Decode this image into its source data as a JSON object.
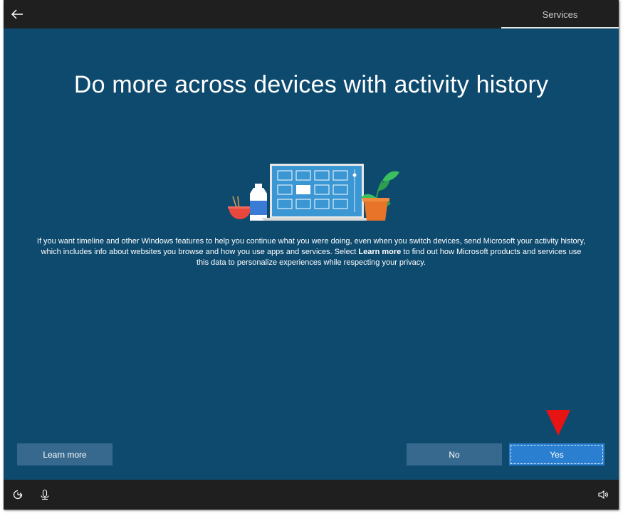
{
  "header": {
    "tab_label": "Services"
  },
  "main": {
    "title": "Do more across devices with activity history",
    "body_before_bold": "If you want timeline and other Windows features to help you continue what you were doing, even when you switch devices, send Microsoft your activity history, which includes info about websites you browse and how you use apps and services. Select ",
    "body_bold": "Learn more",
    "body_after_bold": " to find out how Microsoft products and services use this data to personalize experiences while respecting your privacy."
  },
  "buttons": {
    "learn_more": "Learn more",
    "no": "No",
    "yes": "Yes"
  },
  "icons": {
    "back": "back-arrow-icon",
    "ease_of_access": "ease-of-access-icon",
    "microphone": "microphone-icon",
    "volume": "volume-icon",
    "annotation": "red-down-arrow-indicator"
  },
  "colors": {
    "background": "#0e4a6e",
    "bar": "#1f1f1f",
    "secondary_button": "#36698d",
    "primary_button": "#2a7fd1",
    "indicator": "#e81313"
  }
}
